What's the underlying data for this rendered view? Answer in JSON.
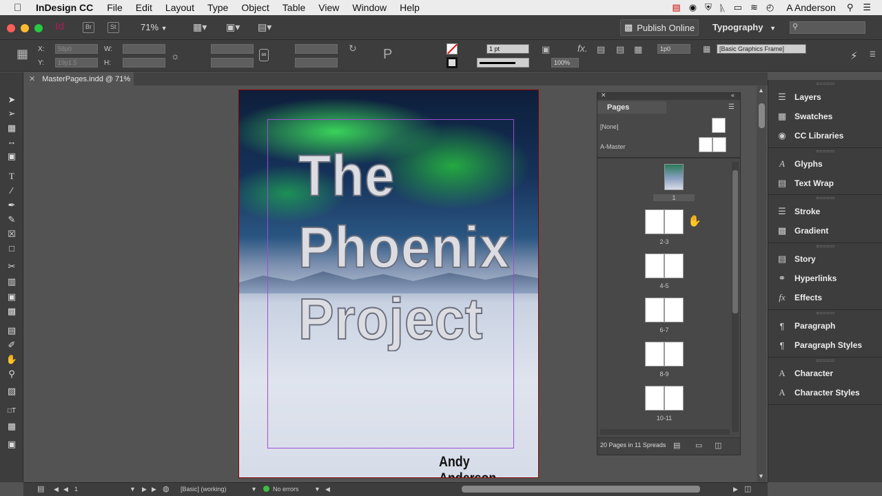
{
  "menubar": {
    "app_name": "InDesign CC",
    "menus": [
      "File",
      "Edit",
      "Layout",
      "Type",
      "Object",
      "Table",
      "View",
      "Window",
      "Help"
    ],
    "user": "A Anderson"
  },
  "appbar": {
    "app_badge": "Id",
    "bridge_badge": "Br",
    "stock_badge": "St",
    "zoom": "71%",
    "publish_label": "Publish Online",
    "workspace": "Typography"
  },
  "control": {
    "x_label": "X:",
    "y_label": "Y:",
    "w_label": "W:",
    "h_label": "H:",
    "x_value": "58p0",
    "y_value": "19p1.5",
    "stroke_weight": "1 pt",
    "opacity": "100%",
    "offset": "1p0",
    "object_style": "[Basic Graphics Frame]"
  },
  "document": {
    "tab_title": "MasterPages.indd @ 71%",
    "cover_title_lines": [
      "The",
      "Phoenix",
      "Project"
    ],
    "cover_author": "Andy Anderson"
  },
  "pages_panel": {
    "tab_label": "Pages",
    "masters": [
      "[None]",
      "A-Master"
    ],
    "spreads": [
      "1",
      "2-3",
      "4-5",
      "6-7",
      "8-9",
      "10-11"
    ],
    "footer": "20 Pages in 11 Spreads"
  },
  "right_panels": {
    "groups": [
      [
        "Layers",
        "Swatches",
        "CC Libraries"
      ],
      [
        "Glyphs",
        "Text Wrap"
      ],
      [
        "Stroke",
        "Gradient"
      ],
      [
        "Story",
        "Hyperlinks",
        "Effects"
      ],
      [
        "Paragraph",
        "Paragraph Styles"
      ],
      [
        "Character",
        "Character Styles"
      ]
    ]
  },
  "statusbar": {
    "page_number": "1",
    "preflight_profile": "[Basic] (working)",
    "errors": "No errors"
  },
  "colors": {
    "aurora_green": "#3cdc5a",
    "margin_guide": "#a04cd8",
    "page_bleed": "#8a0000"
  }
}
